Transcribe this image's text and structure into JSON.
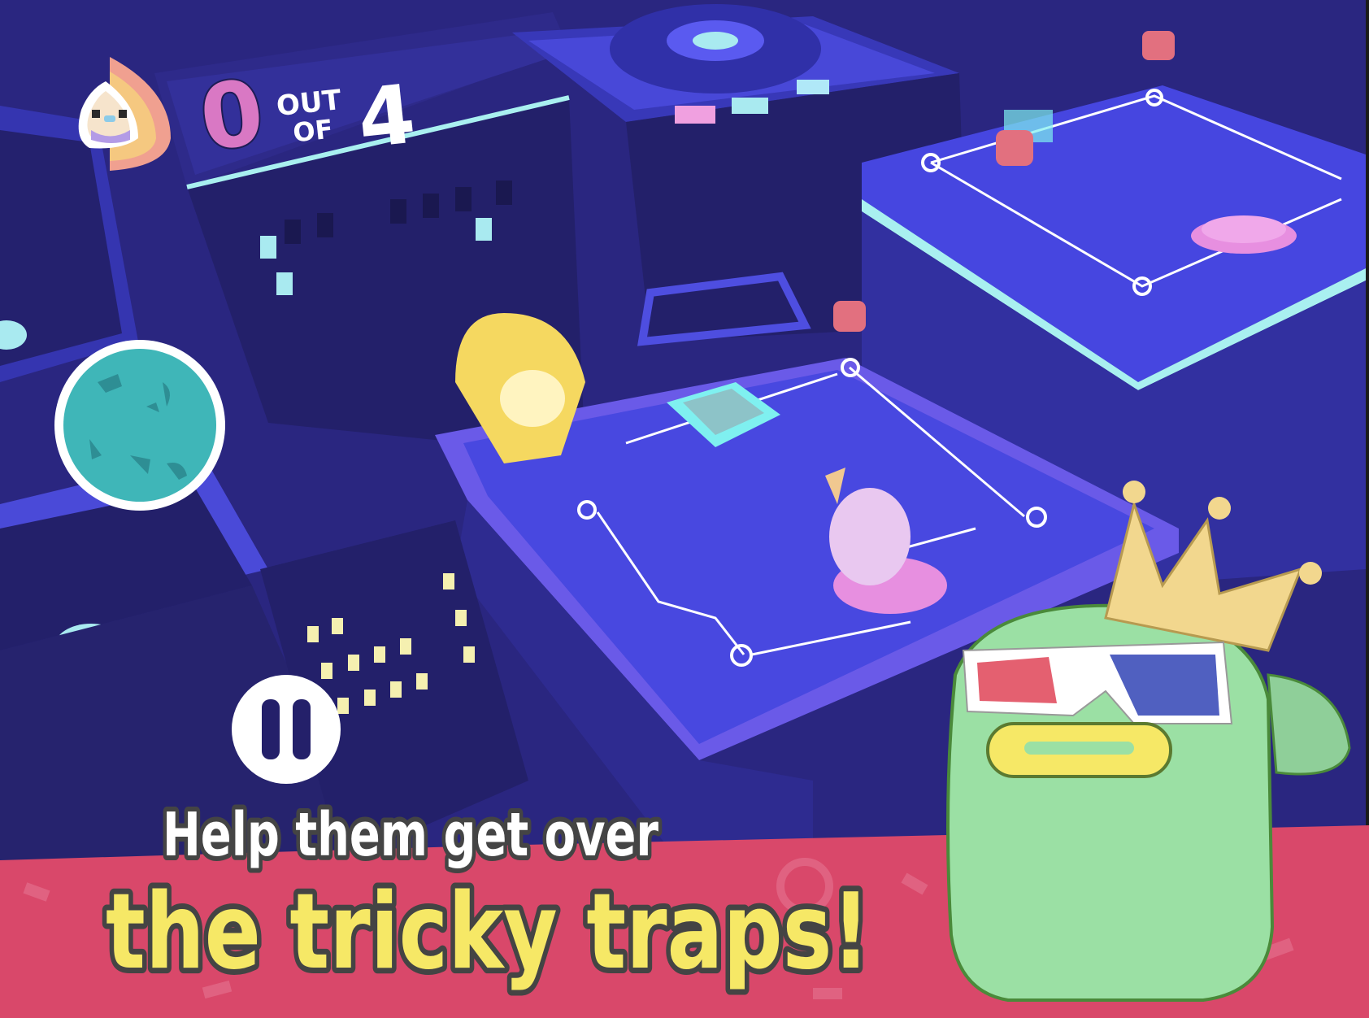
{
  "hud": {
    "score_current": "0",
    "score_out": "OUT",
    "score_of": "OF",
    "score_total": "4",
    "character_icon": "hooded-character-icon",
    "pause_icon": "pause-icon",
    "joystick_icon": "virtual-joystick"
  },
  "caption": {
    "line1": "Help them get over",
    "line2": "the tricky traps!"
  },
  "colors": {
    "sky": "#2a2680",
    "rooftop": "#4646e0",
    "banner": "#d9486a",
    "caption_yellow": "#f6e866",
    "score_pink": "#d978c4",
    "joystick": "#3fb6b8"
  }
}
